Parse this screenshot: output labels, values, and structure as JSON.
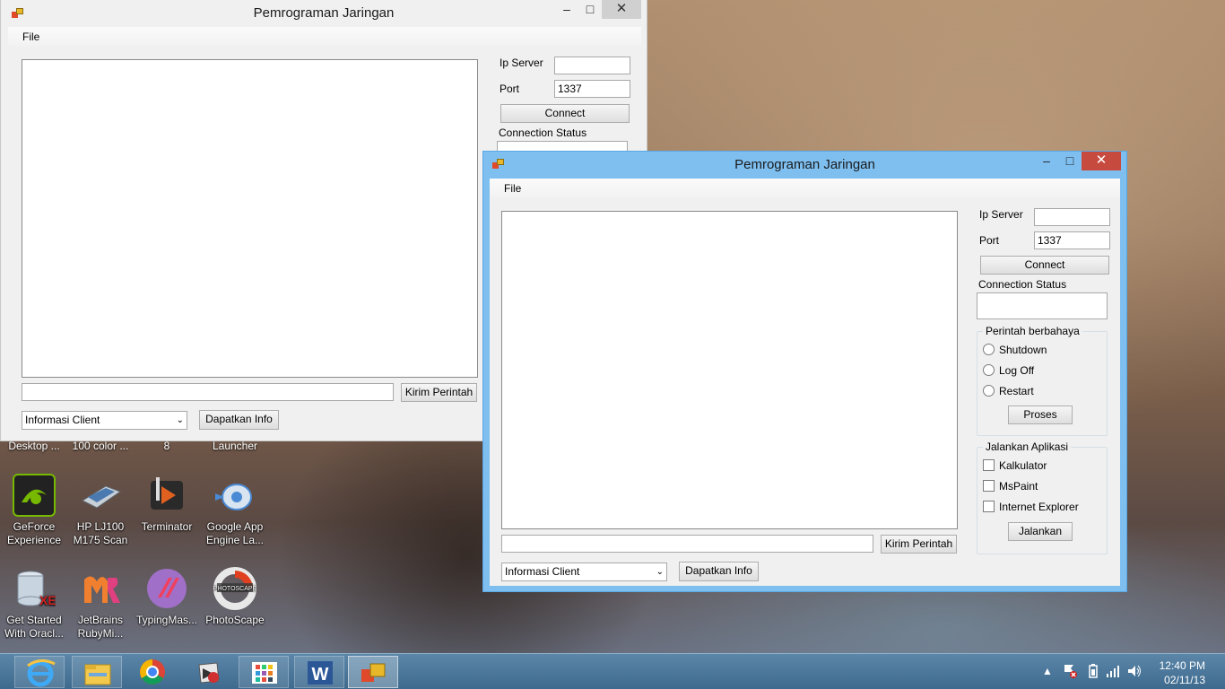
{
  "window_title": "Pemrograman Jaringan",
  "menu": {
    "file": "File"
  },
  "form": {
    "ip_server_label": "Ip Server",
    "ip_server_value": "",
    "port_label": "Port",
    "port_value": "1337",
    "connect_button": "Connect",
    "connection_status_label": "Connection Status",
    "connection_status_value": "",
    "command_input_value": "",
    "send_command_button": "Kirim Perintah",
    "info_combo_value": "Informasi Client",
    "get_info_button": "Dapatkan Info",
    "dangerous_group_title": "Perintah berbahaya",
    "radio_shutdown": "Shutdown",
    "radio_logoff": "Log Off",
    "radio_restart": "Restart",
    "process_button": "Proses",
    "apps_group_title": "Jalankan Aplikasi",
    "check_calculator": "Kalkulator",
    "check_mspaint": "MsPaint",
    "check_ie": "Internet Explorer",
    "run_button": "Jalankan"
  },
  "desktop_icons": {
    "row0": [
      "Desktop ...",
      "100 color ...",
      "8",
      "Launcher"
    ],
    "row1": [
      {
        "label1": "GeForce",
        "label2": "Experience",
        "icon": "nvidia-icon",
        "color": "#76b900"
      },
      {
        "label1": "HP LJ100",
        "label2": "M175 Scan",
        "icon": "scanner-icon",
        "color": "#9aa6b0"
      },
      {
        "label1": "Terminator",
        "label2": "",
        "icon": "terminator-icon",
        "color": "#e06020"
      },
      {
        "label1": "Google App",
        "label2": "Engine La...",
        "icon": "appengine-icon",
        "color": "#4a8ad4"
      }
    ],
    "row2": [
      {
        "label1": "Get Started",
        "label2": "With Oracl...",
        "icon": "oracle-db-icon",
        "color": "#c8d4e0"
      },
      {
        "label1": "JetBrains",
        "label2": "RubyMi...",
        "icon": "rubymine-icon",
        "color": "#f08030"
      },
      {
        "label1": "TypingMas...",
        "label2": "",
        "icon": "typingmaster-icon",
        "color": "#a070c8"
      },
      {
        "label1": "PhotoScape",
        "label2": "",
        "icon": "photoscape-icon",
        "color": "#e8e8e8"
      }
    ]
  },
  "taskbar": {
    "items": [
      "internet-explorer-icon",
      "file-explorer-icon",
      "chrome-icon",
      "winamp-icon",
      "apps-grid-icon",
      "word-icon",
      "winforms-app-icon"
    ],
    "time": "12:40 PM",
    "date": "02/11/13"
  }
}
